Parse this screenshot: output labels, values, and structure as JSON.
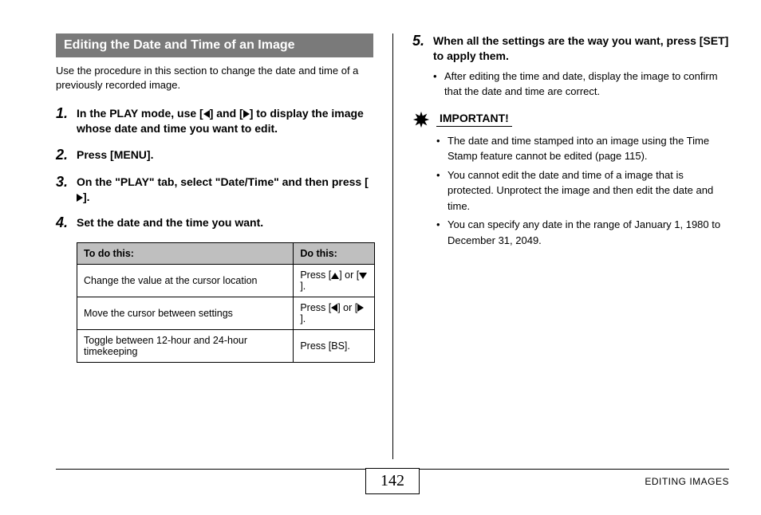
{
  "section_title": "Editing the Date and Time of an Image",
  "intro": "Use the procedure in this section to change the date and time of a previously recorded image.",
  "steps": {
    "s1": {
      "num": "1.",
      "pre": "In the PLAY mode, use [",
      "mid": "] and [",
      "post": "] to display the image whose date and time you want to edit."
    },
    "s2": {
      "num": "2.",
      "text": "Press [MENU]."
    },
    "s3": {
      "num": "3.",
      "pre": "On the \"PLAY\" tab, select \"Date/Time\" and then press [",
      "post": "]."
    },
    "s4": {
      "num": "4.",
      "text": "Set the date and the time you want."
    },
    "s5": {
      "num": "5.",
      "text": "When all the settings are the way you want, press [SET] to apply them.",
      "sub": "After editing the time and date, display the image to confirm that the date and time are correct."
    }
  },
  "table": {
    "headers": {
      "c1": "To do this:",
      "c2": "Do this:"
    },
    "rows": [
      {
        "c1": "Change the value at the cursor location",
        "c2_pre": "Press [",
        "c2_mid": "] or [",
        "c2_post": "].",
        "icons": [
          "up",
          "down"
        ]
      },
      {
        "c1": "Move the cursor between settings",
        "c2_pre": "Press [",
        "c2_mid": "] or [",
        "c2_post": "].",
        "icons": [
          "left",
          "right"
        ]
      },
      {
        "c1": "Toggle between 12-hour and 24-hour timekeeping",
        "c2_full": "Press [BS]."
      }
    ]
  },
  "important_label": "IMPORTANT!",
  "notes": [
    "The date and time stamped into an image using the Time Stamp feature cannot be edited (page 115).",
    "You cannot edit the date and time of a image that is protected. Unprotect the image and then edit the date and time.",
    "You can specify any date in the range of January 1, 1980 to December 31, 2049."
  ],
  "page_number": "142",
  "footer_text": "EDITING IMAGES"
}
